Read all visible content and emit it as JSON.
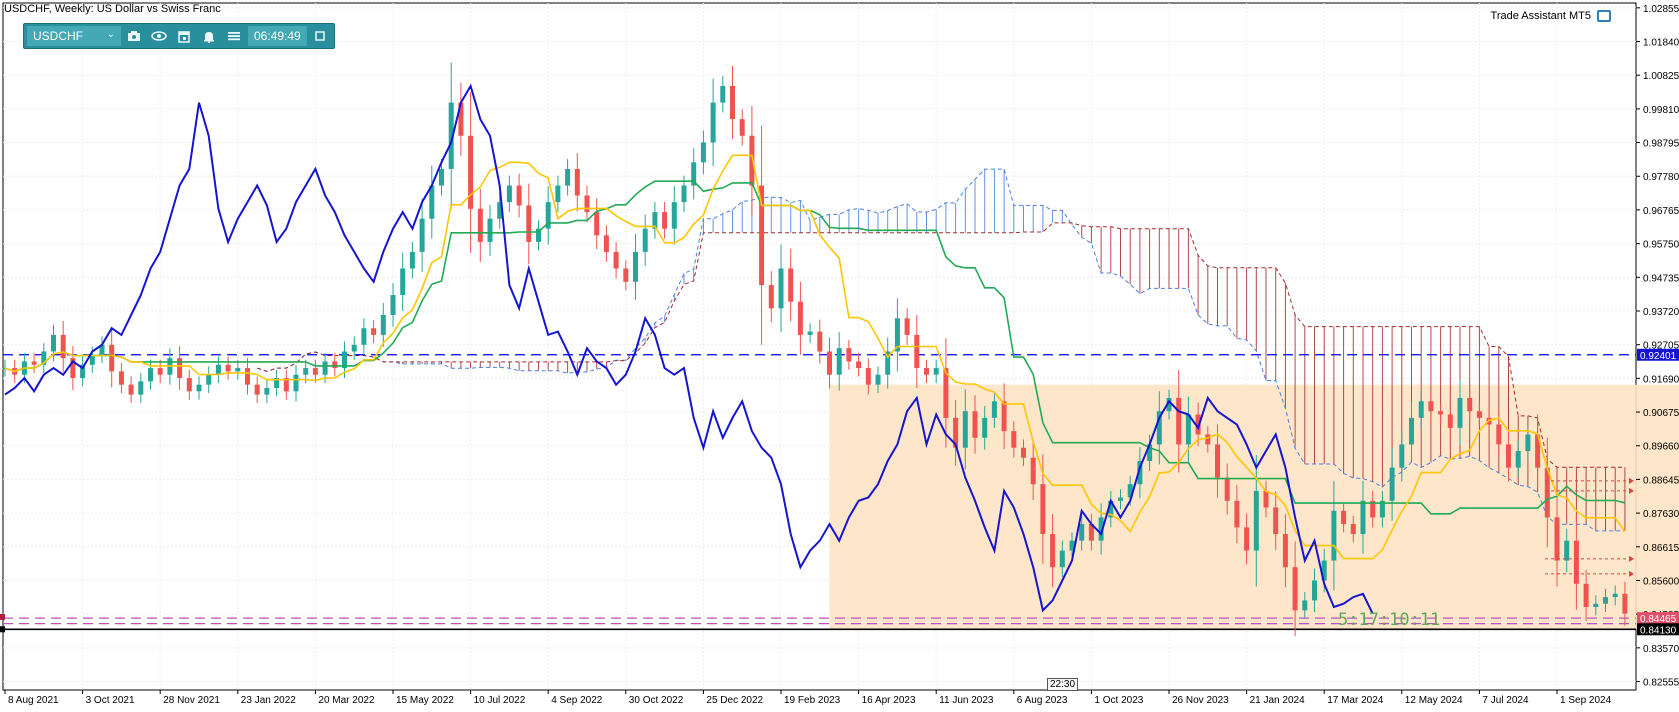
{
  "title": "USDCHF, Weekly:  US Dollar vs Swiss Franc",
  "toolbar": {
    "symbol": "USDCHF",
    "caret": "⌄",
    "time": "06:49:49",
    "icons": [
      "camera-icon",
      "eye-icon",
      "calendar-icon",
      "bell-icon",
      "menu-icon",
      "window-icon"
    ]
  },
  "trade_assistant": "Trade Assistant MT5",
  "timer": "5:17:10:11",
  "crosshair_time_label": "22:30",
  "colors": {
    "bull": "#26a69a",
    "bear": "#ef5350",
    "fast_ma": "#ffc600",
    "slow_ma": "#22aa55",
    "lagging": "#1515d0",
    "cloud_bear": "#a52a2a",
    "cloud_bull": "#4a7fe0",
    "zone": "#fde3c3",
    "line_blue": "#0000ff",
    "line_pink": "#c050c0"
  },
  "chart_data": {
    "type": "candlestick",
    "timeframe": "Weekly",
    "ylim": [
      0.823,
      1.03
    ],
    "y_ticks": [
      "1.02855",
      "1.01840",
      "1.00825",
      "0.99810",
      "0.98795",
      "0.97780",
      "0.96765",
      "0.95750",
      "0.94735",
      "0.93720",
      "0.92705",
      "0.91690",
      "0.90675",
      "0.89660",
      "0.88645",
      "0.87630",
      "0.86615",
      "0.85600",
      "0.84585",
      "0.83570",
      "0.82555"
    ],
    "x_labels": [
      "8 Aug 2021",
      "3 Oct 2021",
      "28 Nov 2021",
      "23 Jan 2022",
      "20 Mar 2022",
      "15 May 2022",
      "10 Jul 2022",
      "4 Sep 2022",
      "30 Oct 2022",
      "25 Dec 2022",
      "19 Feb 2023",
      "16 Apr 2023",
      "11 Jun 2023",
      "6 Aug 2023",
      "1 Oct 2023",
      "26 Nov 2023",
      "21 Jan 2024",
      "17 Mar 2024",
      "12 May 2024",
      "7 Jul 2024",
      "1 Sep 2024"
    ],
    "bars_between_labels": 8,
    "bars_visible": 164,
    "bars_right_shift": 26,
    "close": [
      0.92,
      0.918,
      0.922,
      0.921,
      0.925,
      0.93,
      0.923,
      0.917,
      0.921,
      0.924,
      0.927,
      0.919,
      0.915,
      0.912,
      0.916,
      0.92,
      0.918,
      0.923,
      0.917,
      0.913,
      0.915,
      0.918,
      0.921,
      0.919,
      0.92,
      0.915,
      0.912,
      0.914,
      0.917,
      0.913,
      0.918,
      0.92,
      0.918,
      0.922,
      0.92,
      0.925,
      0.927,
      0.932,
      0.93,
      0.936,
      0.942,
      0.95,
      0.955,
      0.965,
      0.975,
      0.98,
      1.0,
      0.99,
      0.968,
      0.958,
      0.965,
      0.97,
      0.975,
      0.969,
      0.958,
      0.962,
      0.97,
      0.975,
      0.98,
      0.972,
      0.967,
      0.96,
      0.955,
      0.95,
      0.946,
      0.955,
      0.962,
      0.967,
      0.962,
      0.97,
      0.975,
      0.982,
      0.988,
      1.0,
      1.005,
      0.995,
      0.99,
      0.975,
      0.945,
      0.938,
      0.95,
      0.94,
      0.93,
      0.931,
      0.925,
      0.918,
      0.926,
      0.922,
      0.92,
      0.915,
      0.918,
      0.925,
      0.935,
      0.93,
      0.92,
      0.918,
      0.92,
      0.905,
      0.896,
      0.907,
      0.899,
      0.905,
      0.91,
      0.901,
      0.896,
      0.893,
      0.885,
      0.87,
      0.86,
      0.865,
      0.868,
      0.873,
      0.868,
      0.875,
      0.88,
      0.881,
      0.885,
      0.892,
      0.897,
      0.907,
      0.911,
      0.897,
      0.906,
      0.9,
      0.897,
      0.887,
      0.88,
      0.872,
      0.865,
      0.883,
      0.878,
      0.87,
      0.86,
      0.847,
      0.85,
      0.856,
      0.862,
      0.877,
      0.873,
      0.87,
      0.88,
      0.875,
      0.88,
      0.89,
      0.897,
      0.905,
      0.91,
      0.907,
      0.906,
      0.902,
      0.911,
      0.907,
      0.905,
      0.903,
      0.897,
      0.89,
      0.895,
      0.9,
      0.89,
      0.875,
      0.862,
      0.868,
      0.855,
      0.848,
      0.849,
      0.851,
      0.852,
      0.846
    ],
    "indicators": [
      "Ichimoku Kinko Hyo (Tenkan-sen, Kijun-sen, Chikou Span, Kumo)"
    ],
    "horizontal_lines": [
      {
        "price": 0.92401,
        "label": "0.92401",
        "style": "dashed",
        "color": "#0000ff"
      },
      {
        "price": 0.8413,
        "label": "0.84130",
        "style": "solid",
        "color": "#000000"
      },
      {
        "price": 0.84465,
        "label": "0.84465",
        "style": "dashed",
        "color": "#c050c0"
      },
      {
        "price": 0.843,
        "style": "dashed",
        "color": "#c050c0"
      }
    ],
    "red_arrow_levels": [
      0.886,
      0.883,
      0.8625,
      0.858
    ],
    "zone": {
      "from_bar": 85,
      "to_bar": 186,
      "price_top": 0.915,
      "price_bottom": 0.8413
    },
    "grid": true
  }
}
